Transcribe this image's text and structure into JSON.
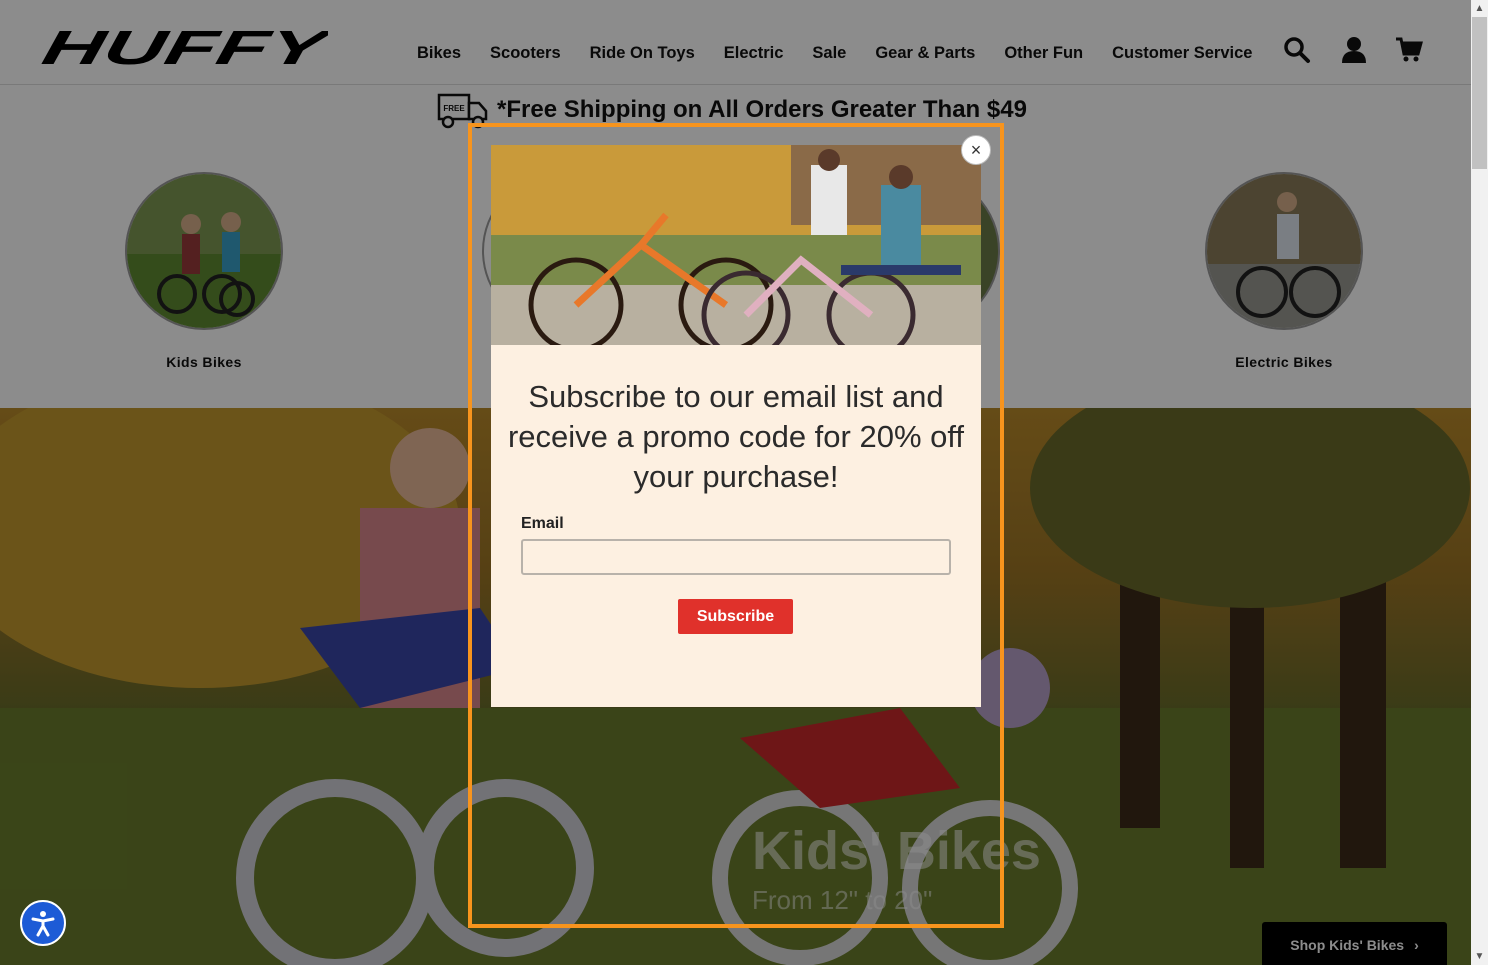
{
  "brand": {
    "name": "HUFFY"
  },
  "nav": {
    "items": [
      "Bikes",
      "Scooters",
      "Ride On Toys",
      "Electric",
      "Sale",
      "Gear & Parts",
      "Other Fun",
      "Customer Service"
    ]
  },
  "header_icons": [
    "search-icon",
    "account-icon",
    "cart-icon"
  ],
  "promo_bar": {
    "badge": "FREE",
    "text": "*Free Shipping on All Orders Greater Than $49"
  },
  "categories": [
    {
      "label": "Kids Bikes"
    },
    {
      "label": "Electric Bikes"
    }
  ],
  "hero": {
    "title": "Kids' Bikes",
    "subtitle": "From 12\" to 20\"",
    "cta": "Shop Kids' Bikes"
  },
  "modal": {
    "close_symbol": "×",
    "heading": "Subscribe to our email list and receive a promo code for 20% off your purchase!",
    "email_label": "Email",
    "email_value": "",
    "subscribe_label": "Subscribe"
  },
  "colors": {
    "modal_frame": "#f7941d",
    "modal_bg": "#fdf0e1",
    "subscribe_button": "#e0312b",
    "accessibility_button": "#1d5bd6"
  }
}
